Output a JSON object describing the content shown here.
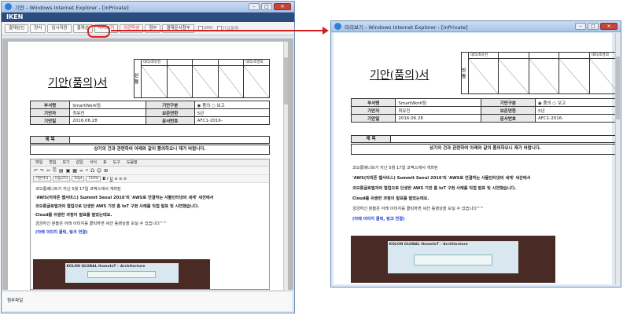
{
  "left_window": {
    "title": "기안 - Windows Internet Explorer - [InPrivate]",
    "brand": "IKEN",
    "toolbar": [
      "결재상신",
      "양식",
      "임시저장",
      "결재선",
      "미리보기",
      "의견작성",
      "첨부",
      "결재문서첨부"
    ],
    "checks": [
      "SMS",
      "긴급결재"
    ],
    "attach_label": "첨부파일"
  },
  "right_window": {
    "title": "미리보기 - Windows Internet Explorer - [InPrivate]"
  },
  "doc": {
    "title": "기안(품의)서",
    "sign_label": "신청",
    "sign_headers": [
      "대리/최유진",
      "",
      "",
      "",
      "대리/조영희"
    ],
    "info": {
      "dept_k": "부서명",
      "dept_v": "SmartWork팀",
      "type_k": "기안구분",
      "type_v1": "품의",
      "type_v2": "보고",
      "drafter_k": "기안자",
      "drafter_v": "최유진",
      "keep_k": "보존연한",
      "keep_v": "5년",
      "date_k": "기안일",
      "date_v": "2016.06.28",
      "no_k": "문서번호",
      "no_v": "AFC1-2016-"
    },
    "subject_k": "제 목",
    "intro": "상기의 건과 관련하여 아래와 같이 품의하오니 재가 바랍니다.",
    "body": [
      "코오롱베니트가 지난 5월 17일 코엑스에서 개최된",
      "'AWS(아마존 웹서비스) Summit Seoul 2016'의 'AWS로 연결하는 사물인터넷의 세계' 세션에서",
      "코오롱글로벌과의 협업으로 단생한 AWS 기반 홈 IoT 구현 사례를 직접 발표 및 시연했습니다.",
      "Cloud를 쉬쌍한 과정이 발표를 말았는데요.",
      "궁금하신 분들은 아래 이미지를 클릭하면 세션 동영상을 보실 수 있습니다^^",
      "(아래 이미지 클릭, 링크 연결)"
    ],
    "photo_caption": "KOLON GLOBAL HomeIoT – Architecture"
  },
  "editor": {
    "menus": [
      "파일",
      "편집",
      "보기",
      "삽입",
      "서식",
      "표",
      "도구",
      "도움말"
    ],
    "format": [
      "기본서식",
      "나눔고딕",
      "10pt",
      "110%"
    ],
    "format_buttons": [
      "B",
      "I",
      "U"
    ]
  },
  "colors": {
    "accent": "#2b4c7c",
    "highlight": "#e02020",
    "link": "#1a3fc8"
  }
}
